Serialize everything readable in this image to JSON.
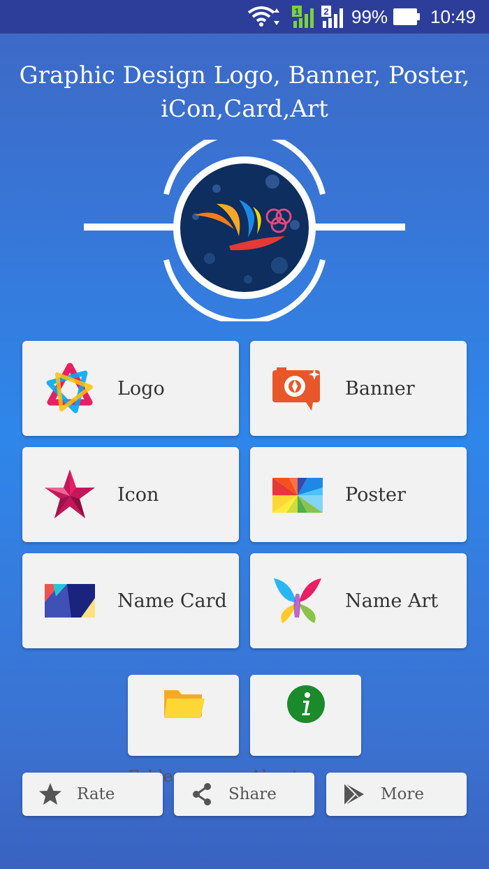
{
  "status_bar": {
    "battery_percent": "99%",
    "time": "10:49",
    "sim1_label": "1",
    "sim2_label": "2",
    "icons": [
      "wifi-icon",
      "signal-icon",
      "battery-icon"
    ]
  },
  "header": {
    "title_line1": "Graphic Design Logo, Banner, Poster,",
    "title_line2": "iCon,Card,Art"
  },
  "menu": {
    "logo": "Logo",
    "banner": "Banner",
    "icon": "Icon",
    "poster": "Poster",
    "name_card": "Name Card",
    "name_art": "Name Art"
  },
  "secondary": {
    "folder": "Folder",
    "about": "About"
  },
  "footer": {
    "rate": "Rate",
    "share": "Share",
    "more": "More"
  },
  "colors": {
    "status_bar": "#2d3e9a",
    "card_bg": "#f2f2f2",
    "text": "#333333",
    "secondary_text": "#555555"
  }
}
